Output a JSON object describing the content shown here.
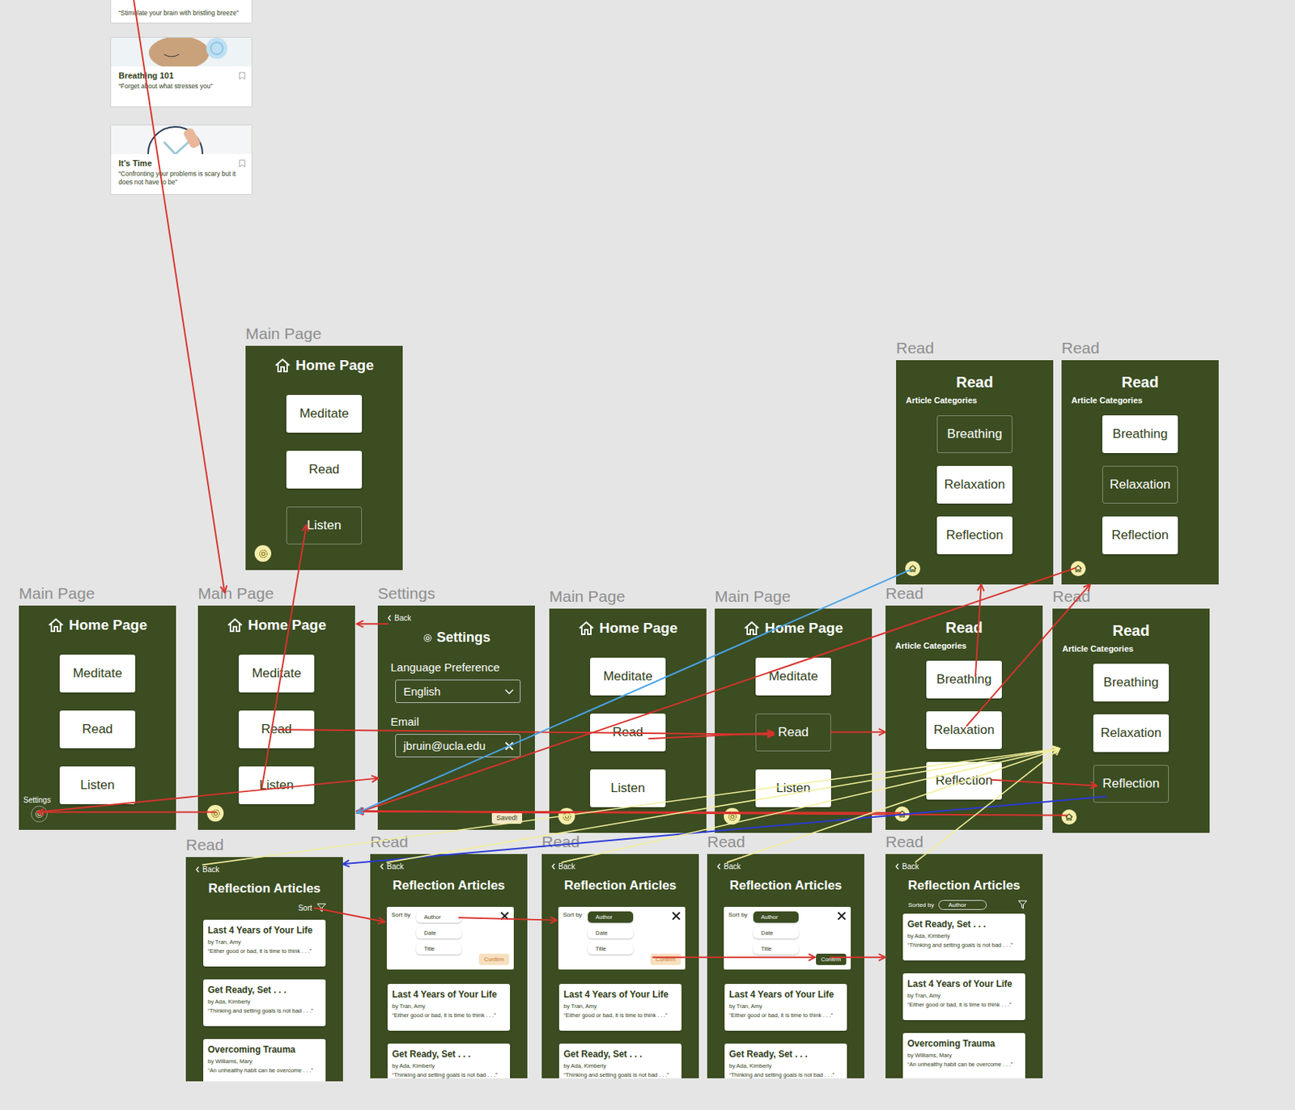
{
  "article_cards": [
    {
      "quote": "“Stimulate your brain with bristling breeze”"
    },
    {
      "title": "Breathing 101",
      "quote": "“Forget about what stresses you”"
    },
    {
      "title": "It’s Time",
      "quote": "“Confronting your problems is scary but it does not have to be”"
    }
  ],
  "frames": [
    {
      "label": "Main Page",
      "kind": "home",
      "title": "Home Page",
      "buttons": [
        {
          "label": "Meditate",
          "selected": false
        },
        {
          "label": "Read",
          "selected": false
        },
        {
          "label": "Listen",
          "selected": true
        }
      ]
    },
    {
      "label": "Main Page",
      "kind": "home",
      "title": "Home Page",
      "hint": "Settings",
      "buttons": [
        {
          "label": "Meditate",
          "selected": false
        },
        {
          "label": "Read",
          "selected": false
        },
        {
          "label": "Listen",
          "selected": false
        }
      ]
    },
    {
      "label": "Main Page",
      "kind": "home",
      "title": "Home Page",
      "buttons": [
        {
          "label": "Meditate",
          "selected": false
        },
        {
          "label": "Read",
          "selected": false
        },
        {
          "label": "Listen",
          "selected": false
        }
      ]
    },
    {
      "label": "Settings",
      "kind": "settings",
      "back": "Back",
      "title": "Settings",
      "language_label": "Language Preference",
      "language_value": "English",
      "email_label": "Email",
      "email_value": "jbruin@ucla.edu",
      "saved": "Saved!"
    },
    {
      "label": "Main Page",
      "kind": "home",
      "title": "Home Page",
      "buttons": [
        {
          "label": "Meditate",
          "selected": false
        },
        {
          "label": "Read",
          "selected": false
        },
        {
          "label": "Listen",
          "selected": false
        }
      ]
    },
    {
      "label": "Main Page",
      "kind": "home",
      "title": "Home Page",
      "buttons": [
        {
          "label": "Meditate",
          "selected": false
        },
        {
          "label": "Read",
          "selected": true
        },
        {
          "label": "Listen",
          "selected": false
        }
      ]
    },
    {
      "label": "Read",
      "kind": "categories",
      "title": "Read",
      "subtitle": "Article Categories",
      "buttons": [
        {
          "label": "Breathing",
          "selected": true
        },
        {
          "label": "Relaxation",
          "selected": false
        },
        {
          "label": "Reflection",
          "selected": false
        }
      ]
    },
    {
      "label": "Read",
      "kind": "categories",
      "title": "Read",
      "subtitle": "Article Categories",
      "buttons": [
        {
          "label": "Breathing",
          "selected": false
        },
        {
          "label": "Relaxation",
          "selected": true
        },
        {
          "label": "Reflection",
          "selected": false
        }
      ]
    },
    {
      "label": "Read",
      "kind": "categories",
      "title": "Read",
      "subtitle": "Article Categories",
      "buttons": [
        {
          "label": "Breathing",
          "selected": false
        },
        {
          "label": "Relaxation",
          "selected": false
        },
        {
          "label": "Reflection",
          "selected": false
        }
      ]
    },
    {
      "label": "Read",
      "kind": "categories",
      "title": "Read",
      "subtitle": "Article Categories",
      "buttons": [
        {
          "label": "Breathing",
          "selected": false
        },
        {
          "label": "Relaxation",
          "selected": false
        },
        {
          "label": "Reflection",
          "selected": true
        }
      ]
    },
    {
      "label": "Read",
      "kind": "articles",
      "back": "Back",
      "title": "Reflection Articles",
      "sort": "Sort",
      "articles": [
        {
          "title": "Last 4 Years of Your Life",
          "author": "by Tran, Amy",
          "quote": "“Either good or bad, it is time to think . . .”"
        },
        {
          "title": "Get Ready, Set . . .",
          "author": "by Ada, Kimberly",
          "quote": "“Thinking and setting goals is not bad . . .”"
        },
        {
          "title": "Overcoming Trauma",
          "author": "by Williams, Mary",
          "quote": "“An unhealthy habit can be overcome . . .”"
        }
      ]
    },
    {
      "label": "Read",
      "kind": "articles",
      "back": "Back",
      "title": "Reflection Articles",
      "sort_panel": {
        "label": "Sort by",
        "options": [
          {
            "label": "Author",
            "selected": false
          },
          {
            "label": "Date",
            "selected": false
          },
          {
            "label": "Title",
            "selected": false
          }
        ],
        "confirm": {
          "label": "Confirm",
          "selected": false
        }
      },
      "articles": [
        {
          "title": "Last 4 Years of Your Life",
          "author": "by Tran, Amy",
          "quote": "“Either good or bad, it is time to think . . .”"
        },
        {
          "title": "Get Ready, Set . . .",
          "author": "by Ada, Kimberly",
          "quote": "“Thinking and setting goals is not bad . . .”"
        }
      ]
    },
    {
      "label": "Read",
      "kind": "articles",
      "back": "Back",
      "title": "Reflection Articles",
      "sort_panel": {
        "label": "Sort by",
        "options": [
          {
            "label": "Author",
            "selected": true
          },
          {
            "label": "Date",
            "selected": false
          },
          {
            "label": "Title",
            "selected": false
          }
        ],
        "confirm": {
          "label": "Confirm",
          "selected": false
        }
      },
      "articles": [
        {
          "title": "Last 4 Years of Your Life",
          "author": "by Tran, Amy",
          "quote": "“Either good or bad, it is time to think . . .”"
        },
        {
          "title": "Get Ready, Set . . .",
          "author": "by Ada, Kimberly",
          "quote": "“Thinking and setting goals is not bad . . .”"
        }
      ]
    },
    {
      "label": "Read",
      "kind": "articles",
      "back": "Back",
      "title": "Reflection Articles",
      "sort_panel": {
        "label": "Sort by",
        "options": [
          {
            "label": "Author",
            "selected": true
          },
          {
            "label": "Date",
            "selected": false
          },
          {
            "label": "Title",
            "selected": false
          }
        ],
        "confirm": {
          "label": "Confirm",
          "selected": true
        }
      },
      "articles": [
        {
          "title": "Last 4 Years of Your Life",
          "author": "by Tran, Amy",
          "quote": "“Either good or bad, it is time to think . . .”"
        },
        {
          "title": "Get Ready, Set . . .",
          "author": "by Ada, Kimberly",
          "quote": "“Thinking and setting goals is not bad . . .”"
        }
      ]
    },
    {
      "label": "Read",
      "kind": "articles",
      "back": "Back",
      "title": "Reflection Articles",
      "sorted": {
        "label": "Sorted by",
        "value": "Author"
      },
      "articles": [
        {
          "title": "Get Ready, Set . . .",
          "author": "by Ada, Kimberly",
          "quote": "“Thinking and setting goals is not bad . . .”"
        },
        {
          "title": "Last 4 Years of Your Life",
          "author": "by Tran, Amy",
          "quote": "“Either good or bad, it is time to think . . .”"
        },
        {
          "title": "Overcoming Trauma",
          "author": "by Williams, Mary",
          "quote": "“An unhealthy habit can be overcome . . .”"
        }
      ]
    }
  ]
}
